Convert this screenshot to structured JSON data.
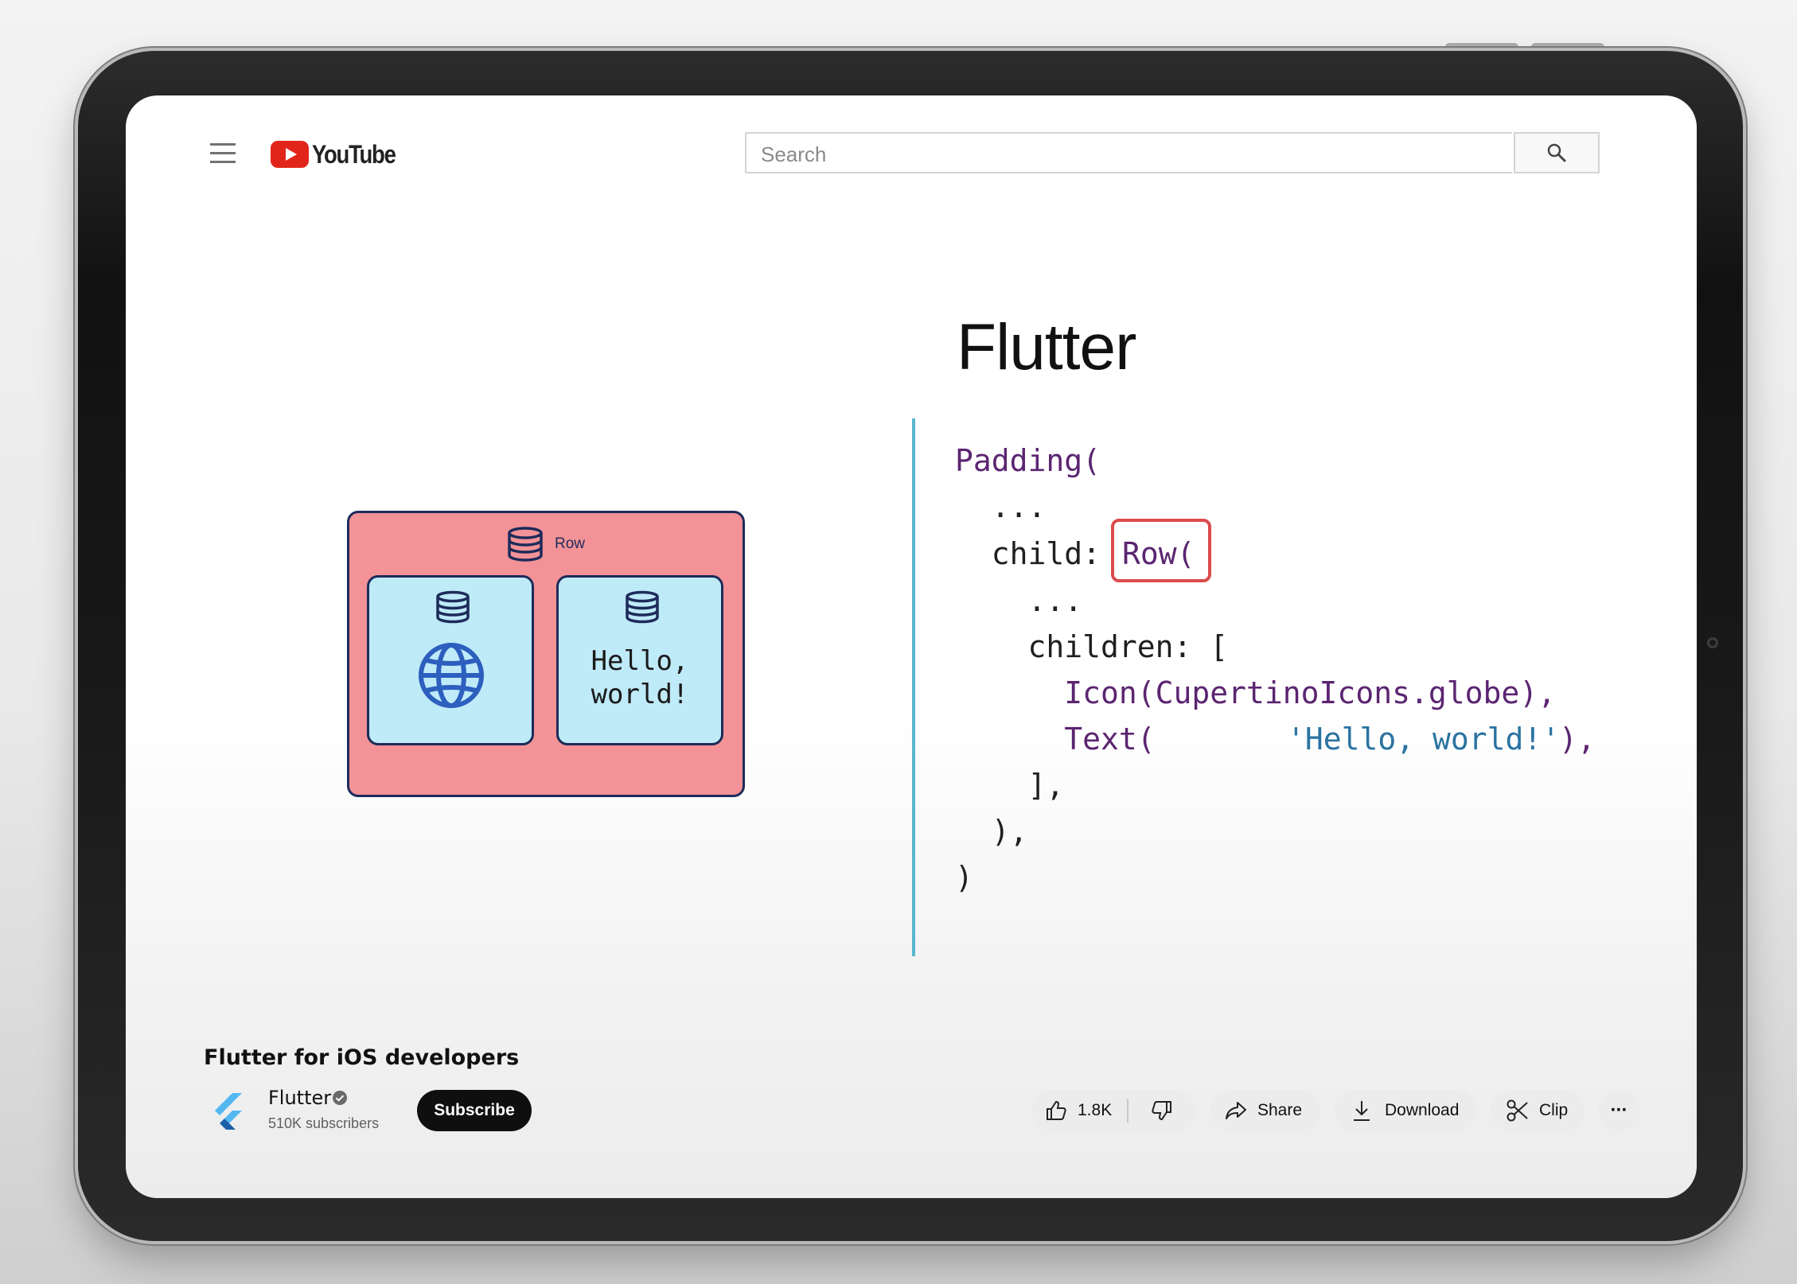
{
  "header": {
    "logo_text": "YouTube",
    "search_placeholder": "Search"
  },
  "slide": {
    "title": "Flutter",
    "code_lines": [
      "Padding(",
      "  ...",
      "  child: ",
      "Row(",
      "    ...",
      "    children: [",
      "      Icon(CupertinoIcons.globe),",
      "      Text(",
      "'Hello, world!'",
      "),",
      "    ],",
      "  ),",
      ")"
    ],
    "diagram": {
      "row_label": "Row",
      "text_widget": "Hello,\nworld!"
    }
  },
  "video": {
    "title": "Flutter for iOS developers",
    "channel_name": "Flutter",
    "subscribers": "510K subscribers",
    "subscribe_label": "Subscribe",
    "likes": "1.8K",
    "share_label": "Share",
    "download_label": "Download",
    "clip_label": "Clip",
    "more_label": "···"
  },
  "colors": {
    "youtube_red": "#e1251b",
    "row_box": "#f39397",
    "child_box": "#bfeaf8",
    "highlight": "#dc4c4c",
    "divider": "#5ab5cf",
    "code_purple": "#5b2571",
    "code_string_blue": "#2a73a1"
  },
  "icons": [
    "menu-icon",
    "youtube-play-icon",
    "search-icon",
    "widget-stack-icon",
    "globe-icon",
    "flutter-logo-icon",
    "verified-icon",
    "thumbs-up-icon",
    "thumbs-down-icon",
    "share-icon",
    "download-icon",
    "clip-icon",
    "more-icon"
  ]
}
